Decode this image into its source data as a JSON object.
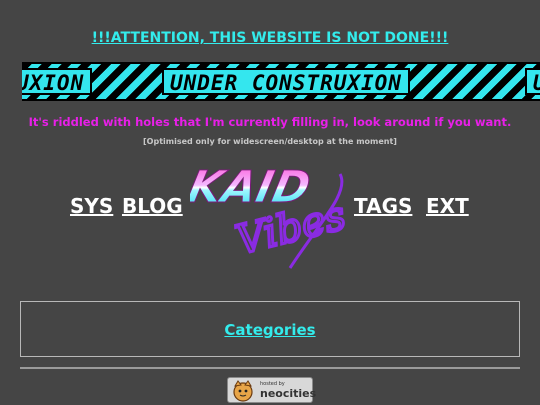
{
  "attention": "!!!ATTENTION, THIS WEBSITE IS NOT DONE!!!",
  "banner": {
    "segments": [
      "UXION",
      "UNDER CONSTRUXION",
      "U"
    ]
  },
  "riddled": "It's riddled with holes that I'm currently filling in, look around if you want.",
  "optimised": "[Optimised only for widescreen/desktop at the moment]",
  "nav": {
    "sys": "SYS",
    "blog": "BLOG",
    "tags": "TAGS",
    "ext": "EXT"
  },
  "logo": {
    "text": "KAID",
    "script": "Vibes"
  },
  "categories": "Categories",
  "hosted": {
    "small": "hosted by",
    "big": "neocities"
  },
  "colors": {
    "background": "#454545",
    "accent_cyan": "#33ecec",
    "accent_magenta": "#e81fe8"
  }
}
